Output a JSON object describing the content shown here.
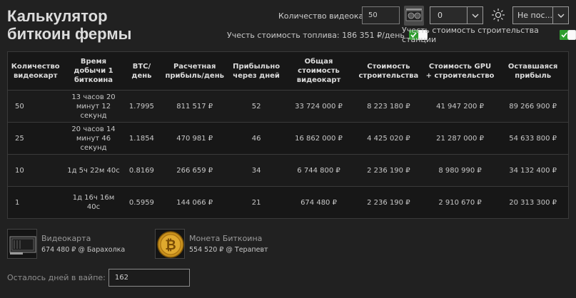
{
  "title": {
    "line1": "Калькулятор",
    "line2": "биткоин фермы"
  },
  "controls": {
    "gpu_count_label": "Количество видеокарт",
    "gpu_count_value": "50",
    "select_value": "0",
    "select_options_label": "Не пос...",
    "fuel_label": "Учесть стоимость топлива: 186 351 ₽/день",
    "fuel_checked": true,
    "build_label": "Учесть стоимость строительства станции",
    "build_checked": true
  },
  "table": {
    "headers": [
      "Количество видеокарт",
      "Время добычи 1 биткоина",
      "BTC/ день",
      "Расчетная прибыль/день",
      "Прибыльно через дней",
      "Общая стоимость видеокарт",
      "Стоимость строительства",
      "Стоимость GPU + строительство",
      "Оставшаяся прибыль"
    ],
    "rows": [
      [
        "50",
        "13 часов 20 минут 12 секунд",
        "1.7995",
        "811 517 ₽",
        "52",
        "33 724 000 ₽",
        "8 223 180 ₽",
        "41 947 200 ₽",
        "89 266 900 ₽"
      ],
      [
        "25",
        "20 часов 14 минут 46 секунд",
        "1.1854",
        "470 981 ₽",
        "46",
        "16 862 000 ₽",
        "4 425 020 ₽",
        "21 287 000 ₽",
        "54 633 800 ₽"
      ],
      [
        "10",
        "1д 5ч 22м 40с",
        "0.8169",
        "266 659 ₽",
        "34",
        "6 744 800 ₽",
        "2 236 190 ₽",
        "8 980 990 ₽",
        "34 132 400 ₽"
      ],
      [
        "1",
        "1д 16ч 16м 40с",
        "0.5959",
        "144 066 ₽",
        "21",
        "674 480 ₽",
        "2 236 190 ₽",
        "2 910 670 ₽",
        "20 313 300 ₽"
      ]
    ]
  },
  "items": [
    {
      "name": "Видеокарта",
      "price": "674 480 ₽ @ Барахолка",
      "icon": "gpu-icon"
    },
    {
      "name": "Монета Биткоина",
      "price": "554 520 ₽ @ Терапевт",
      "icon": "bitcoin-icon"
    }
  ],
  "days": {
    "label": "Осталось дней в вайпе:",
    "value": "162"
  },
  "colors": {
    "background": "#212121",
    "table_bg": "#171717",
    "toggle_green": "#2f9e2f"
  }
}
